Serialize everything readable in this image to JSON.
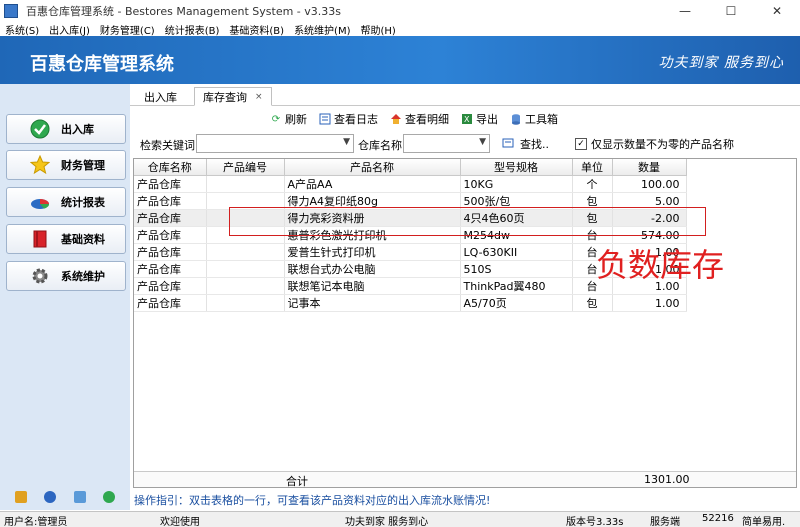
{
  "window": {
    "title": "百惠仓库管理系统 - Bestores Management System - v3.33s",
    "minimize": "—",
    "maximize": "☐",
    "close": "✕"
  },
  "menubar": [
    "系统(S)",
    "出入库(J)",
    "财务管理(C)",
    "统计报表(B)",
    "基础资料(B)",
    "系统维护(M)",
    "帮助(H)"
  ],
  "banner": {
    "app_name": "百惠仓库管理系统",
    "slogan": "功夫到家 服务到心"
  },
  "sidebar": {
    "items": [
      {
        "label": "出入库",
        "icon": "check-icon"
      },
      {
        "label": "财务管理",
        "icon": "star-icon"
      },
      {
        "label": "统计报表",
        "icon": "pie-chart-icon"
      },
      {
        "label": "基础资料",
        "icon": "book-icon"
      },
      {
        "label": "系统维护",
        "icon": "gear-icon"
      }
    ]
  },
  "tabs": [
    {
      "label": "出入库",
      "active": false
    },
    {
      "label": "库存查询",
      "active": true,
      "close": "×"
    }
  ],
  "toolbar": {
    "refresh": "刷新",
    "view_log": "查看日志",
    "view_detail": "查看明细",
    "export": "导出",
    "toolbox": "工具箱"
  },
  "search": {
    "keyword_label": "检索关键词",
    "keyword_value": "",
    "warehouse_label": "仓库名称",
    "warehouse_value": "",
    "find_label": "查找..",
    "checkbox_label": "仅显示数量不为零的产品名称",
    "checkbox_checked": true,
    "checkmark": "✓"
  },
  "table": {
    "columns": [
      "仓库名称",
      "产品编号",
      "产品名称",
      "型号规格",
      "单位",
      "数量"
    ],
    "rows": [
      [
        "产品仓库",
        "",
        "A产品AA",
        "10KG",
        "个",
        "100.00"
      ],
      [
        "产品仓库",
        "",
        "得力A4复印纸80g",
        "500张/包",
        "包",
        "5.00"
      ],
      [
        "产品仓库",
        "",
        "得力亮彩资料册",
        "4只4色60页",
        "包",
        "-2.00"
      ],
      [
        "产品仓库",
        "",
        "惠普彩色激光打印机",
        "M254dw",
        "台",
        "574.00"
      ],
      [
        "产品仓库",
        "",
        "爱普生针式打印机",
        "LQ-630KII",
        "台",
        "1.00"
      ],
      [
        "产品仓库",
        "",
        "联想台式办公电脑",
        "510S",
        "台",
        "1.00"
      ],
      [
        "产品仓库",
        "",
        "联想笔记本电脑",
        "ThinkPad翼480",
        "台",
        "1.00"
      ],
      [
        "产品仓库",
        "",
        "记事本",
        "A5/70页",
        "包",
        "1.00"
      ]
    ],
    "selected_row": 2,
    "footer_label": "合计",
    "footer_total": "1301.00"
  },
  "annotation": {
    "text": "负数库存",
    "color": "#e02020"
  },
  "hint": "操作指引：双击表格的一行，可查看该产品资料对应的出入库流水账情况!",
  "statusbar": {
    "user": "用户名:管理员",
    "welcome": "欢迎使用",
    "slogan": "功夫到家 服务到心",
    "version": "版本号3.33s",
    "server": "服务端",
    "port": "52216",
    "mode": "简单易用."
  },
  "colors": {
    "banner": "#1f67b7",
    "sidebar_bg": "#dbe7f5",
    "hint_text": "#1a4fa0"
  }
}
